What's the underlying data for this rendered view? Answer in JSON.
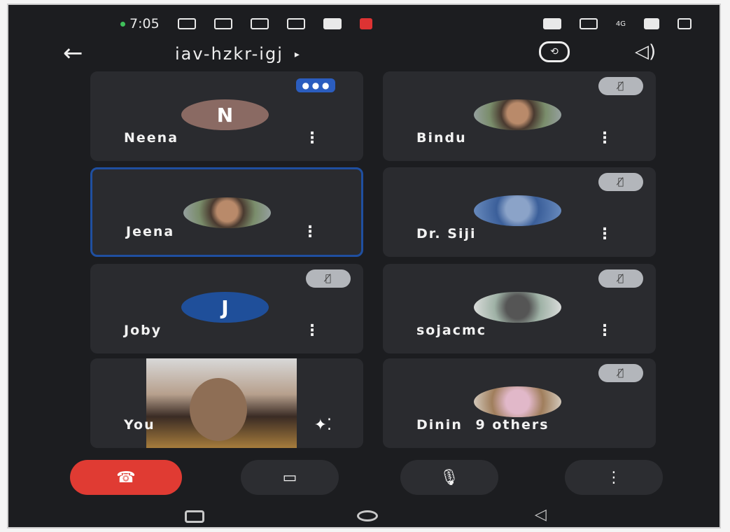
{
  "status_bar": {
    "time": "7:05",
    "network": "4G"
  },
  "top_bar": {
    "meeting_code": "iav-hzkr-igj",
    "caret": "▸"
  },
  "participants": [
    {
      "name": "Neena",
      "initial": "N",
      "avatar_color": "#8a6a63"
    },
    {
      "name": "Bindu"
    },
    {
      "name": "Jeena"
    },
    {
      "name": "Dr. Siji"
    },
    {
      "name": "Joby",
      "initial": "J",
      "avatar_color": "#1f4f9a"
    },
    {
      "name": "sojacmc"
    },
    {
      "name": "You"
    },
    {
      "name": "Dinin",
      "others": "9 others"
    }
  ],
  "icons": {
    "back": "←",
    "more": "⋮",
    "mic_muted": "🎙̸",
    "effects": "✦⁚",
    "hangup": "☎",
    "video": "▭",
    "mic": "🎙",
    "switch_camera": "⟲",
    "speaker": "◁)"
  },
  "colors": {
    "background": "#1c1d20",
    "tile": "#2a2b2f",
    "hangup": "#e03b33",
    "active_border": "#1f4fa0"
  }
}
